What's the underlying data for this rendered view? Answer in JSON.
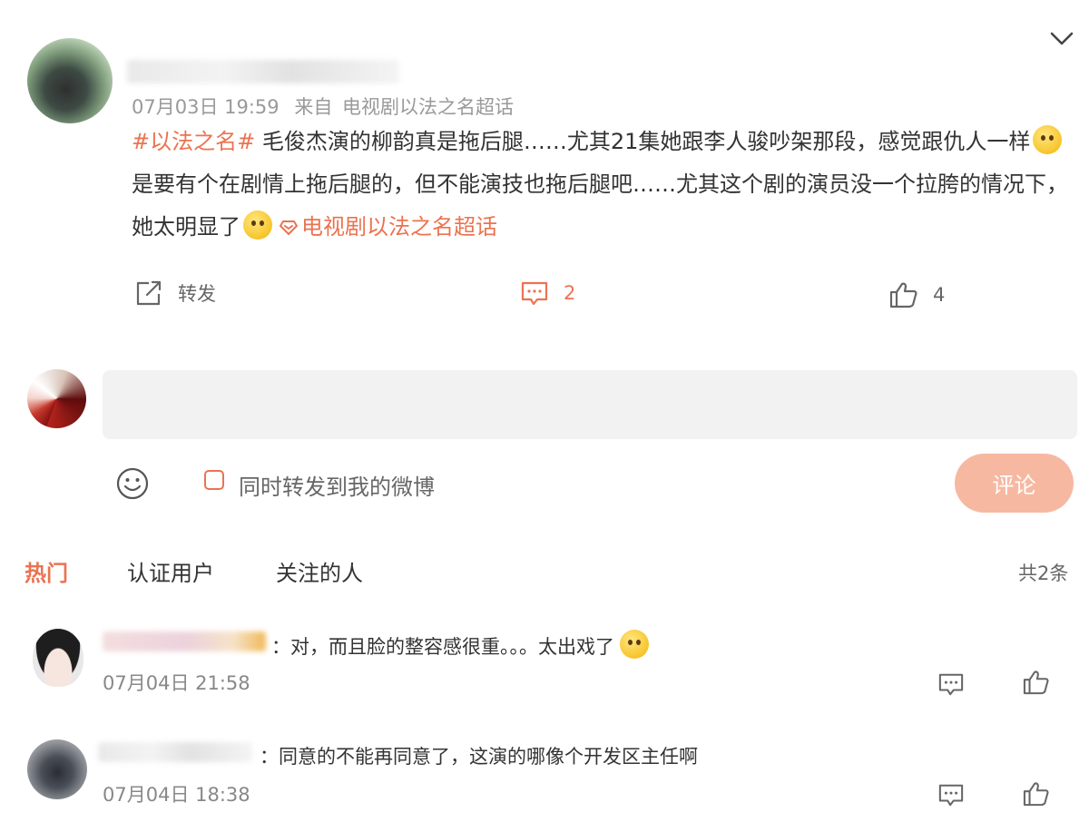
{
  "post": {
    "time": "07月03日 19:59",
    "source_prefix": "来自",
    "source": "电视剧以法之名超话",
    "hashtag": "#以法之名#",
    "text_1": " 毛俊杰演的柳韵真是拖后腿……尤其21集她跟李人骏吵架那段，感觉跟仇人一样",
    "text_2": "是要有个在剧情上拖后腿的，但不能演技也拖后腿吧……尤其这个剧的演员没一个拉胯的情况下，她太明显了",
    "supertopic_link": "电视剧以法之名超话",
    "repost_label": "转发",
    "comment_count": "2",
    "like_count": "4"
  },
  "composer": {
    "placeholder": "",
    "also_repost_label": "同时转发到我的微博",
    "submit_label": "评论"
  },
  "tabs": {
    "hot": "热门",
    "verified": "认证用户",
    "following": "关注的人",
    "total": "共2条"
  },
  "comments": [
    {
      "text": "：对，而且脸的整容感很重。。。太出戏了",
      "time": "07月04日 21:58"
    },
    {
      "text": "：同意的不能再同意了，这演的哪像个开发区主任啊",
      "time": "07月04日 18:38"
    }
  ],
  "icons": {
    "collapse": "chevron-down-icon",
    "repost": "share-icon",
    "comment": "comment-icon",
    "like": "thumbs-up-icon",
    "emoji_picker": "smiley-icon",
    "supertopic": "supertopic-diamond-icon"
  },
  "colors": {
    "accent": "#eb7350",
    "submit_disabled": "#f7b8a1",
    "input_bg": "#f2f2f2"
  }
}
